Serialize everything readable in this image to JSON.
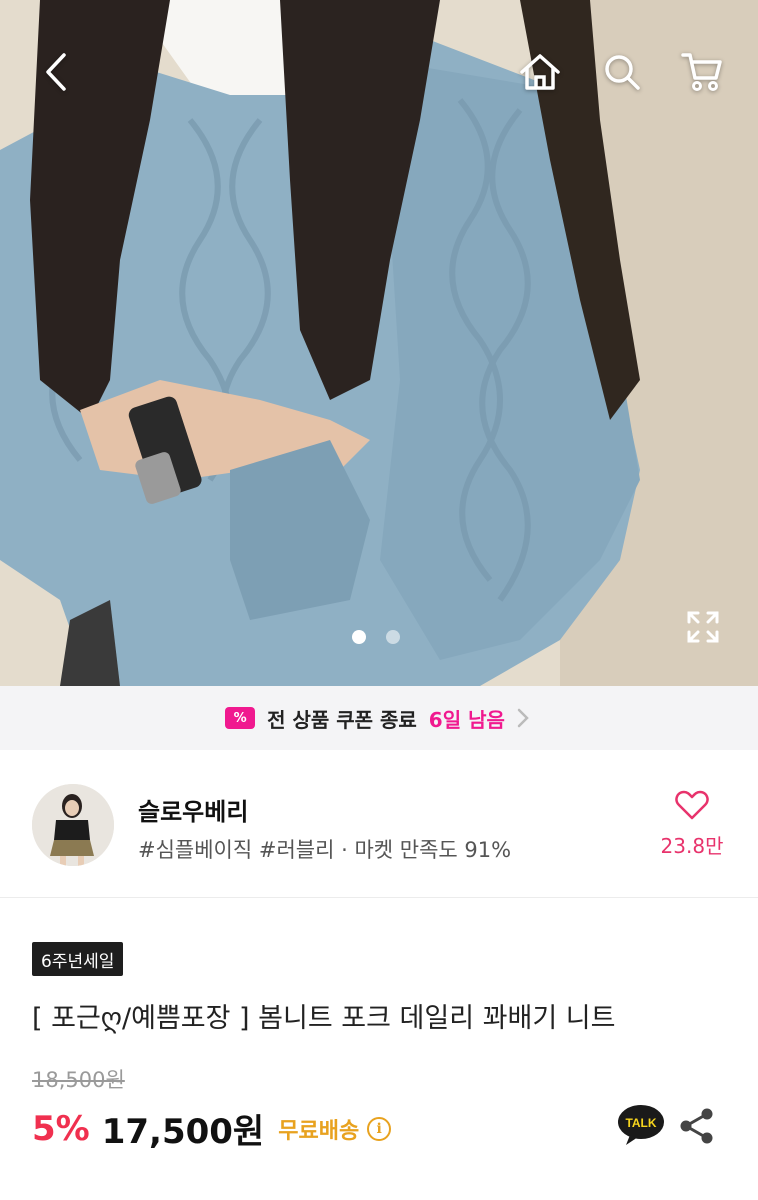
{
  "nav": {
    "icons": [
      "back-icon",
      "home-icon",
      "search-icon",
      "cart-icon"
    ]
  },
  "gallery": {
    "current_slide": 1,
    "slide_count": 2
  },
  "coupon_banner": {
    "badge_text": "%",
    "text": "전 상품 쿠폰 종료",
    "days_left": "6일 남음"
  },
  "store": {
    "name": "슬로우베리",
    "tags": "#심플베이직 #러블리 · 마켓 만족도 91%",
    "likes": "23.8만"
  },
  "product": {
    "badge": "6주년세일",
    "title": "[ 포근ღ/예쁨포장 ] 봄니트 포크 데일리 꽈배기 니트",
    "original_price": "18,500원",
    "discount": "5%",
    "price": "17,500원",
    "shipping": "무료배송",
    "info_icon": "i"
  },
  "actions": {
    "talk_label": "TALK"
  },
  "colors": {
    "accent_pink": "#f0198f",
    "discount_red": "#f0304f",
    "shipping_gold": "#e8a21f",
    "like_red": "#e8336c",
    "sweater_blue": "#8fb0c4"
  }
}
